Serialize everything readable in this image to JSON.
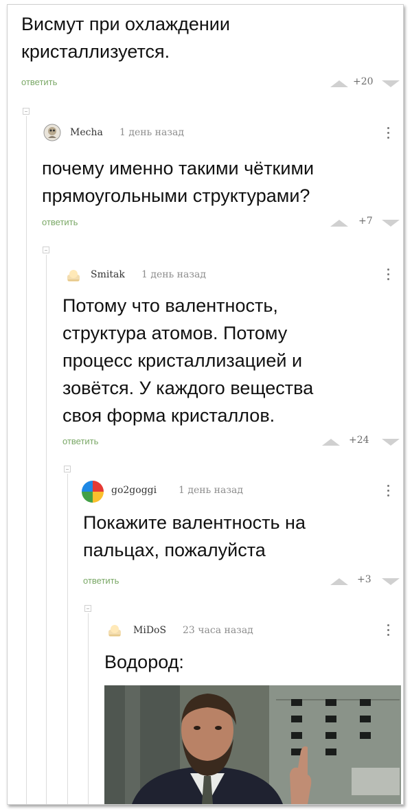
{
  "root_comment": {
    "text_line1": "Висмут при охлаждении",
    "text_line2": "кристаллизуется.",
    "reply_label": "ответить",
    "rating": "+20"
  },
  "comments": [
    {
      "username": "Mecha",
      "time": "1 день назад",
      "lines": [
        "почему именно такими чёткими",
        "прямоугольными структурами?"
      ],
      "reply_label": "ответить",
      "rating": "+7"
    },
    {
      "username": "Smitak",
      "time": "1 день назад",
      "lines": [
        "Потому что валентность,",
        "структура атомов. Потому",
        "процесс кристаллизацией и",
        "зовётся. У каждого вещества",
        "своя форма кристаллов."
      ],
      "reply_label": "ответить",
      "rating": "+24"
    },
    {
      "username": "go2goggi",
      "time": "1 день назад",
      "lines": [
        "Покажите валентность на",
        "пальцах, пожалуйста"
      ],
      "reply_label": "ответить",
      "rating": "+3"
    },
    {
      "username": "MiDoS",
      "time": "23 часа назад",
      "lines": [
        "Водород:"
      ]
    }
  ],
  "colors": {
    "reply_green": "#7aa866",
    "text": "#111111",
    "muted": "#8d8d8d"
  },
  "icons": [
    "collapse-icon",
    "upvote-icon",
    "downvote-icon",
    "more-icon"
  ]
}
